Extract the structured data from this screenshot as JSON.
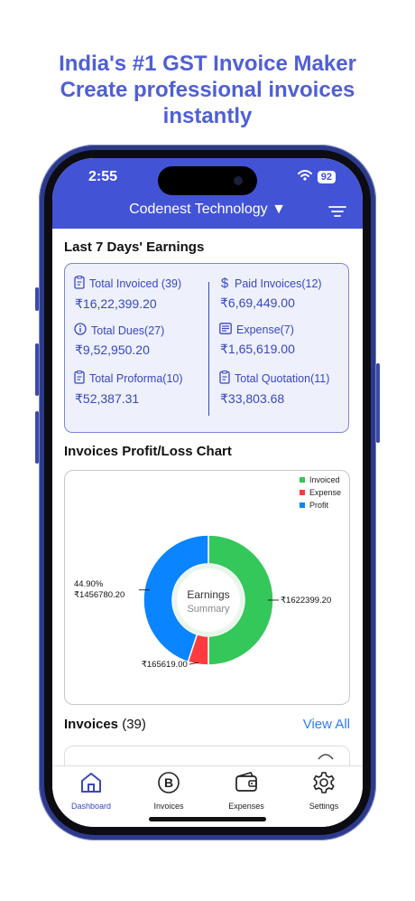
{
  "promo": {
    "line1": "India's #1 GST Invoice Maker",
    "line2": "Create professional invoices",
    "line3": "instantly"
  },
  "status_bar": {
    "time": "2:55",
    "battery": "92"
  },
  "header": {
    "company": "Codenest Technology ▼"
  },
  "earnings": {
    "title": "Last 7 Days' Earnings",
    "items": [
      {
        "label": "Total Invoiced (39)",
        "value": "₹16,22,399.20",
        "icon": "invoice-doc-icon"
      },
      {
        "label": "Paid Invoices(12)",
        "value": "₹6,69,449.00",
        "icon": "dollar-icon"
      },
      {
        "label": "Total Dues(27)",
        "value": "₹9,52,950.20",
        "icon": "info-icon"
      },
      {
        "label": "Expense(7)",
        "value": "₹1,65,619.00",
        "icon": "expense-list-icon"
      },
      {
        "label": "Total Proforma(10)",
        "value": "₹52,387.31",
        "icon": "proforma-doc-icon"
      },
      {
        "label": "Total Quotation(11)",
        "value": "₹33,803.68",
        "icon": "quotation-doc-icon"
      }
    ]
  },
  "chart_section": {
    "title": "Invoices Profit/Loss Chart"
  },
  "chart_data": {
    "type": "pie",
    "center_title": "Earnings",
    "center_subtitle": "Summary",
    "series": [
      {
        "name": "Invoiced",
        "value": 1622399.2,
        "label": "₹1622399.20",
        "color": "#34c759"
      },
      {
        "name": "Expense",
        "value": 165619.0,
        "label": "₹165619.00",
        "color": "#ff3b40"
      },
      {
        "name": "Profit",
        "value": 1456780.2,
        "label": "₹1456780.20",
        "percent_label": "44.90%",
        "color": "#0a84ff"
      }
    ],
    "legend_position": "top-right"
  },
  "invoices": {
    "title": "Invoices",
    "count": "(39)",
    "view_all": "View All"
  },
  "tabs": [
    {
      "label": "Dashboard",
      "icon": "home-icon"
    },
    {
      "label": "Invoices",
      "icon": "invoice-b-icon"
    },
    {
      "label": "Expenses",
      "icon": "wallet-icon"
    },
    {
      "label": "Settings",
      "icon": "gear-icon"
    }
  ],
  "colors": {
    "primary": "#4353d6",
    "accent_text": "#3848c0",
    "link": "#2f7bf5",
    "promo": "#4f5fd6",
    "card_bg": "#eef0fc"
  }
}
